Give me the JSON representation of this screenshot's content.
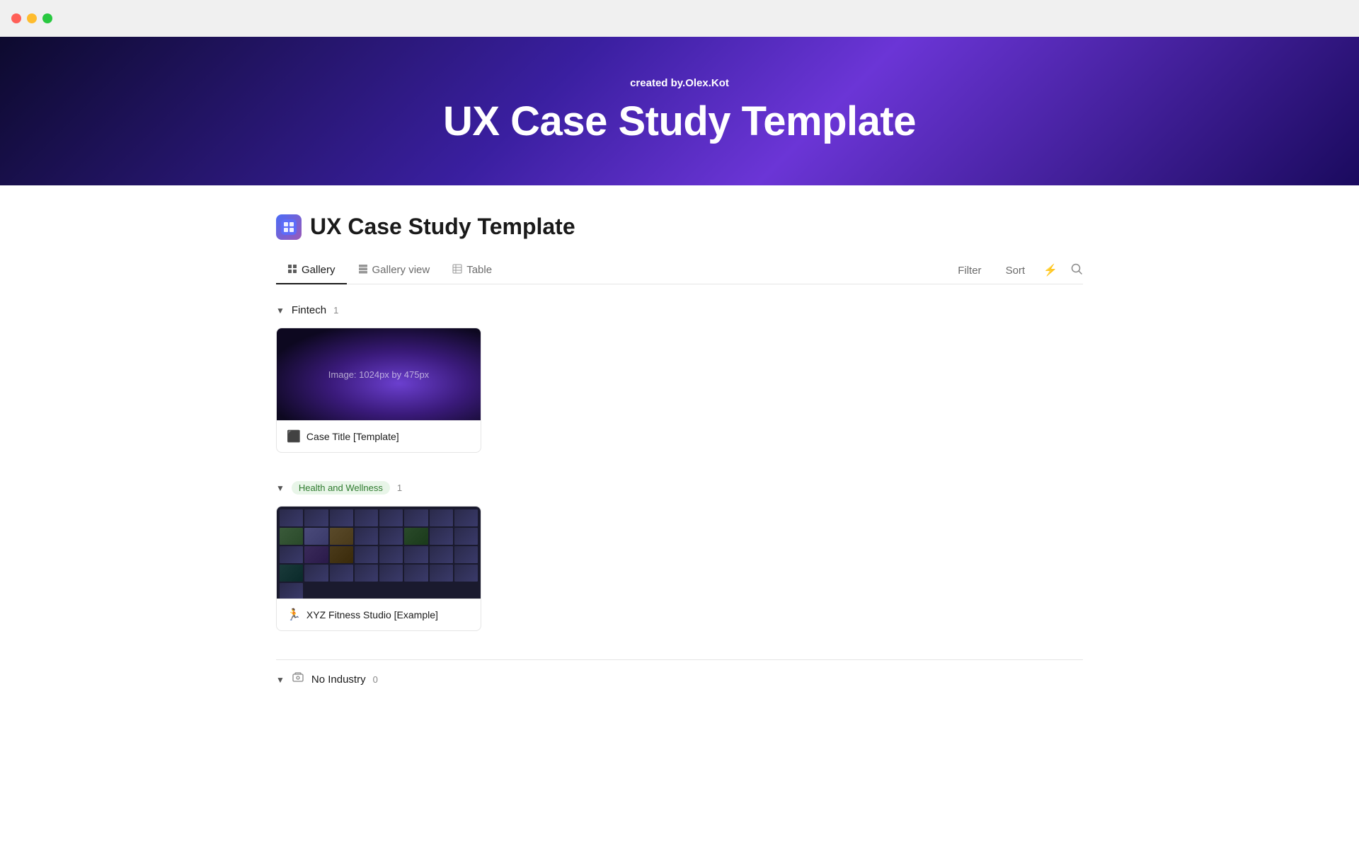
{
  "titlebar": {
    "traffic_lights": [
      "red",
      "yellow",
      "green"
    ]
  },
  "banner": {
    "subtitle": "created by",
    "subtitle_bold": ".Olex.Kot",
    "title": "UX Case Study Template"
  },
  "page": {
    "icon": "🔷",
    "title": "UX Case Study Template"
  },
  "tabs": [
    {
      "id": "gallery",
      "label": "Gallery",
      "active": true,
      "icon": "⊞"
    },
    {
      "id": "gallery-view",
      "label": "Gallery view",
      "active": false,
      "icon": "⊟"
    },
    {
      "id": "table",
      "label": "Table",
      "active": false,
      "icon": "⊞"
    }
  ],
  "toolbar_actions": {
    "filter_label": "Filter",
    "sort_label": "Sort"
  },
  "sections": [
    {
      "id": "fintech",
      "label": "Fintech",
      "count": "1",
      "badge_type": "plain",
      "cards": [
        {
          "id": "case-title-template",
          "image_type": "fintech",
          "image_label": "Image: 1024px by 475px",
          "icon": "⬛",
          "title": "Case Title [Template]"
        }
      ]
    },
    {
      "id": "health-wellness",
      "label": "Health and Wellness",
      "count": "1",
      "badge_type": "pill",
      "cards": [
        {
          "id": "xyz-fitness",
          "image_type": "fitness",
          "image_label": "",
          "icon": "🏃",
          "title": "XYZ Fitness Studio [Example]"
        }
      ]
    },
    {
      "id": "no-industry",
      "label": "No Industry",
      "count": "0",
      "badge_type": "grey",
      "cards": []
    }
  ]
}
